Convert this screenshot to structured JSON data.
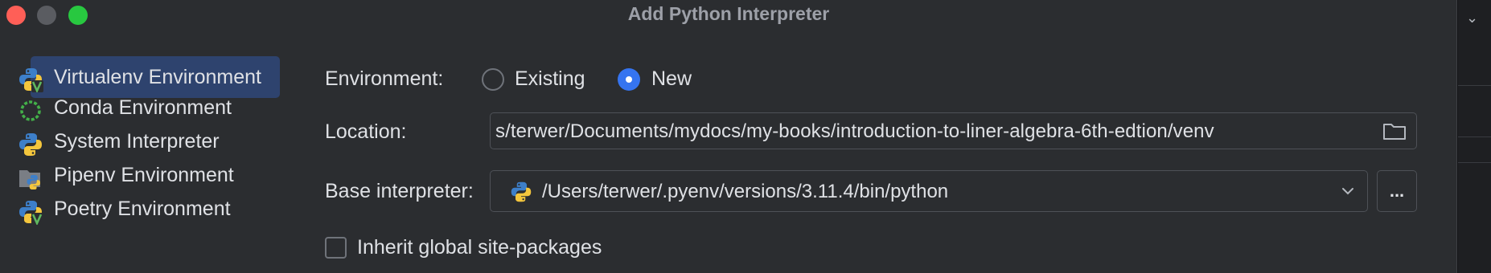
{
  "window": {
    "title": "Add Python Interpreter"
  },
  "sidebar": {
    "items": [
      {
        "label": "Virtualenv Environment",
        "icon": "python-virtualenv-icon",
        "selected": true
      },
      {
        "label": "Conda Environment",
        "icon": "conda-icon",
        "selected": false
      },
      {
        "label": "System Interpreter",
        "icon": "python-icon",
        "selected": false
      },
      {
        "label": "Pipenv Environment",
        "icon": "pipenv-icon",
        "selected": false
      },
      {
        "label": "Poetry Environment",
        "icon": "poetry-icon",
        "selected": false
      }
    ]
  },
  "form": {
    "environment_label": "Environment:",
    "radio_existing_label": "Existing",
    "radio_new_label": "New",
    "selected_environment": "New",
    "location_label": "Location:",
    "location_value": "s/terwer/Documents/mydocs/my-books/introduction-to-liner-algebra-6th-edtion/venv",
    "base_interpreter_label": "Base interpreter:",
    "base_interpreter_value": "/Users/terwer/.pyenv/versions/3.11.4/bin/python",
    "browse_button_label": "...",
    "inherit_label": "Inherit global site-packages",
    "inherit_checked": false
  },
  "colors": {
    "accent": "#3574f0",
    "selection": "#2e436e",
    "background": "#2b2d30",
    "close": "#ff5f57",
    "zoom": "#28c840"
  }
}
